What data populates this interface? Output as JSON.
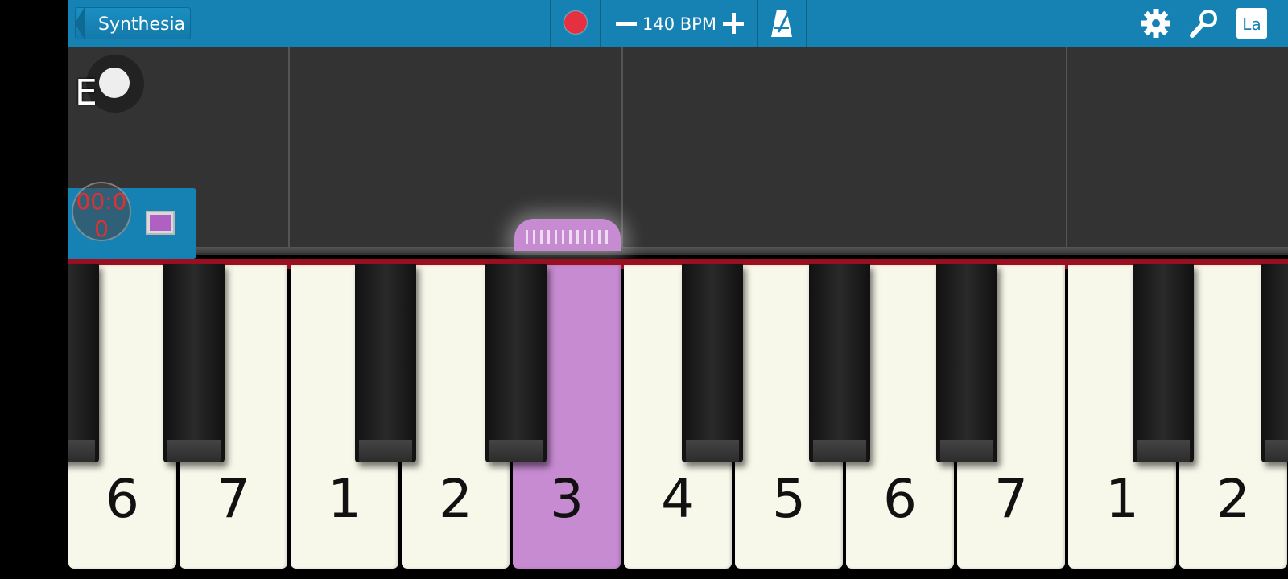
{
  "header": {
    "back_label": "Synthesia",
    "bpm_label": "140 BPM",
    "la_label": "La"
  },
  "roll": {
    "note_label": "E"
  },
  "side_panel": {
    "timer": "00:00"
  },
  "keyboard": {
    "numbers": [
      "6",
      "7",
      "1",
      "2",
      "3",
      "4",
      "5",
      "6",
      "7",
      "1",
      "2"
    ],
    "active_index": 4,
    "active_color": "#c78bd1"
  },
  "colors": {
    "topbar": "#1682b3",
    "record": "#e5303f",
    "roll_bg": "#333333",
    "red_strip": "#9b1020"
  }
}
